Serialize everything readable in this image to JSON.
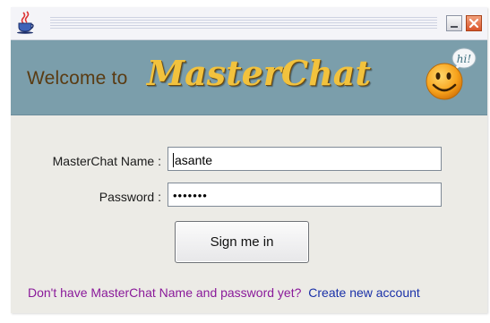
{
  "titlebar": {
    "app_icon": "java-cup-icon",
    "minimize_icon": "minimize-icon",
    "close_icon": "close-icon"
  },
  "banner": {
    "welcome": "Welcome to",
    "brand": "MasterChat",
    "mascot_icon": "smiley-hi-icon",
    "bubble_text": "hi!"
  },
  "form": {
    "name_label": "MasterChat Name :",
    "name_value": "asante",
    "password_label": "Password :",
    "password_value": "•••••••",
    "signin_label": "Sign me in"
  },
  "footer": {
    "prompt": "Don't have MasterChat Name and password yet?",
    "create_link": "Create new account"
  },
  "colors": {
    "banner": "#7b9eab",
    "brand": "#f2c23d",
    "prompt": "#8a1a9a",
    "link": "#1a31a8",
    "close": "#d9542a"
  }
}
